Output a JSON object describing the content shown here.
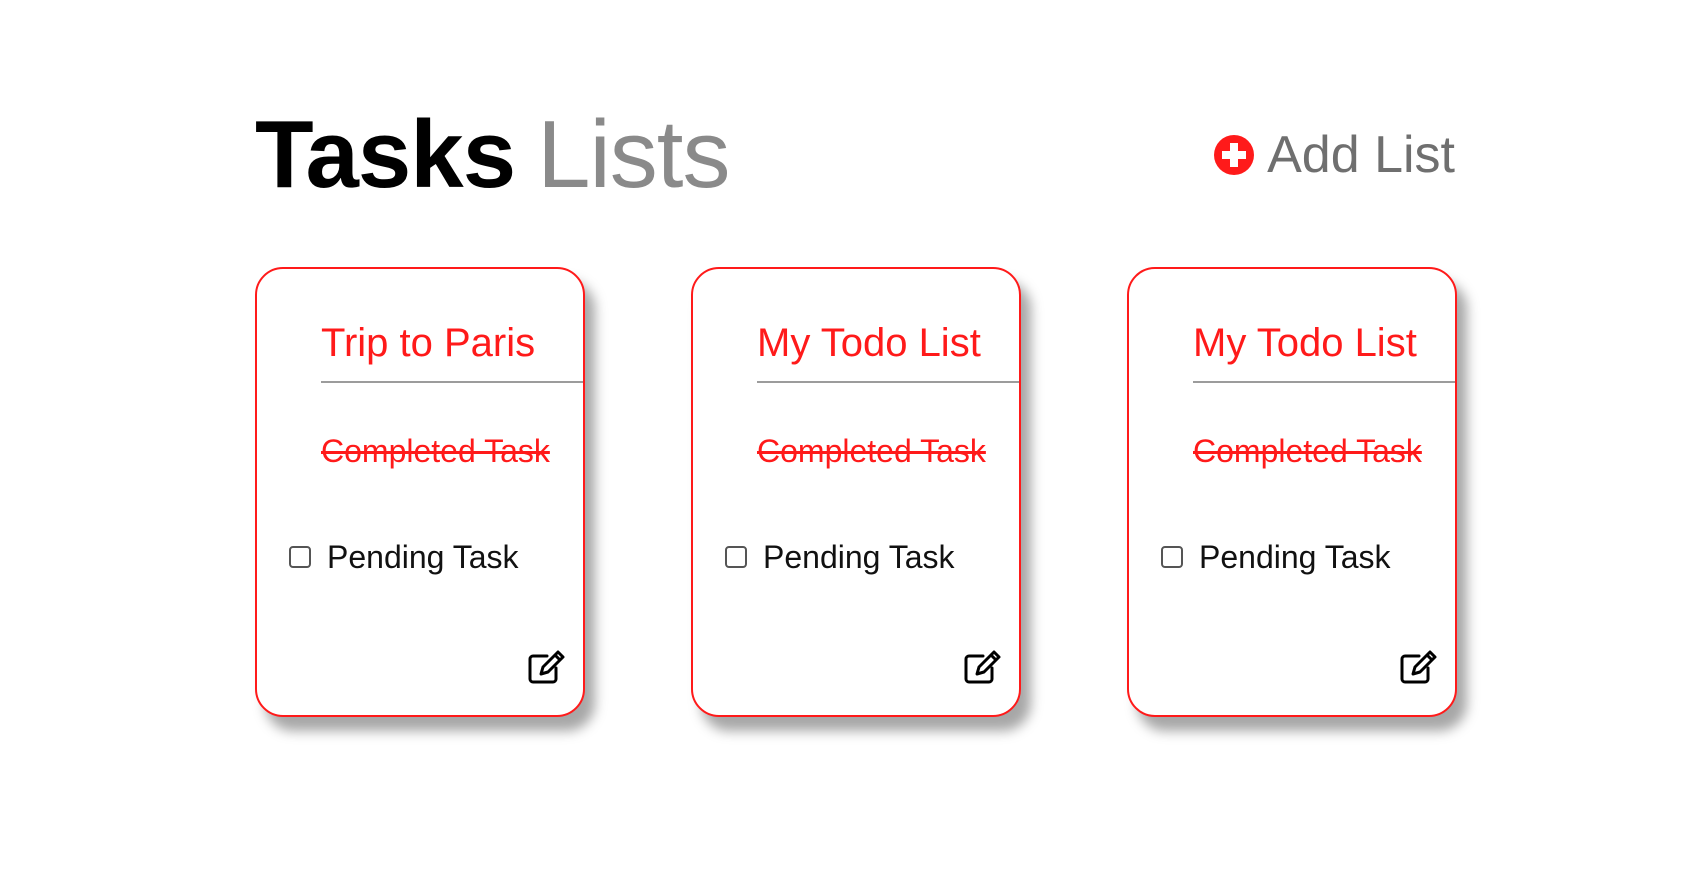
{
  "header": {
    "title_bold": "Tasks",
    "title_light": "Lists",
    "add_list_label": "Add List"
  },
  "icons": {
    "add": "plus-circle-icon",
    "edit": "edit-icon"
  },
  "colors": {
    "accent": "#ff1a1a",
    "title_light": "#8a8a8a",
    "add_label": "#6f6f6f"
  },
  "lists": [
    {
      "title": "Trip to Paris",
      "completed_task": "Completed Task",
      "pending_task": "Pending Task"
    },
    {
      "title": "My Todo List",
      "completed_task": "Completed Task",
      "pending_task": "Pending Task"
    },
    {
      "title": "My Todo List",
      "completed_task": "Completed Task",
      "pending_task": "Pending Task"
    }
  ]
}
